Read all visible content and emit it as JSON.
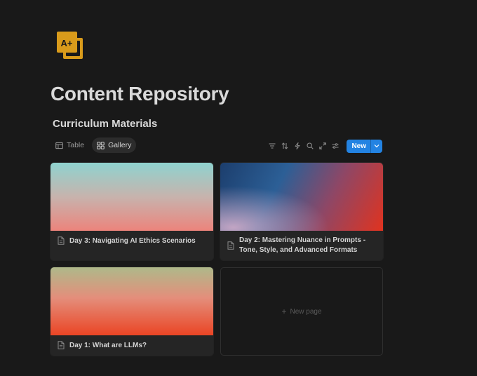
{
  "page": {
    "icon": "a-plus-badge-icon",
    "title": "Content Repository"
  },
  "database": {
    "title": "Curriculum Materials",
    "views": [
      {
        "label": "Table",
        "icon": "table-icon",
        "active": false
      },
      {
        "label": "Gallery",
        "icon": "gallery-icon",
        "active": true
      }
    ],
    "toolbar": {
      "icons": [
        "filter-icon",
        "sort-icon",
        "automation-icon",
        "search-icon",
        "expand-icon",
        "settings-icon"
      ],
      "new_label": "New"
    }
  },
  "gallery": {
    "cards": [
      {
        "title": "Day 3: Navigating AI Ethics Scenarios",
        "icon": "page-icon"
      },
      {
        "title": "Day 2: Mastering Nuance in Prompts - Tone, Style, and Advanced Formats",
        "icon": "page-icon"
      },
      {
        "title": "Day 1: What are LLMs?",
        "icon": "page-icon"
      }
    ],
    "new_page_label": "New page"
  },
  "colors": {
    "background": "#191919",
    "card": "#252525",
    "accent": "#2383e2",
    "icon_gold": "#d99b1b"
  }
}
